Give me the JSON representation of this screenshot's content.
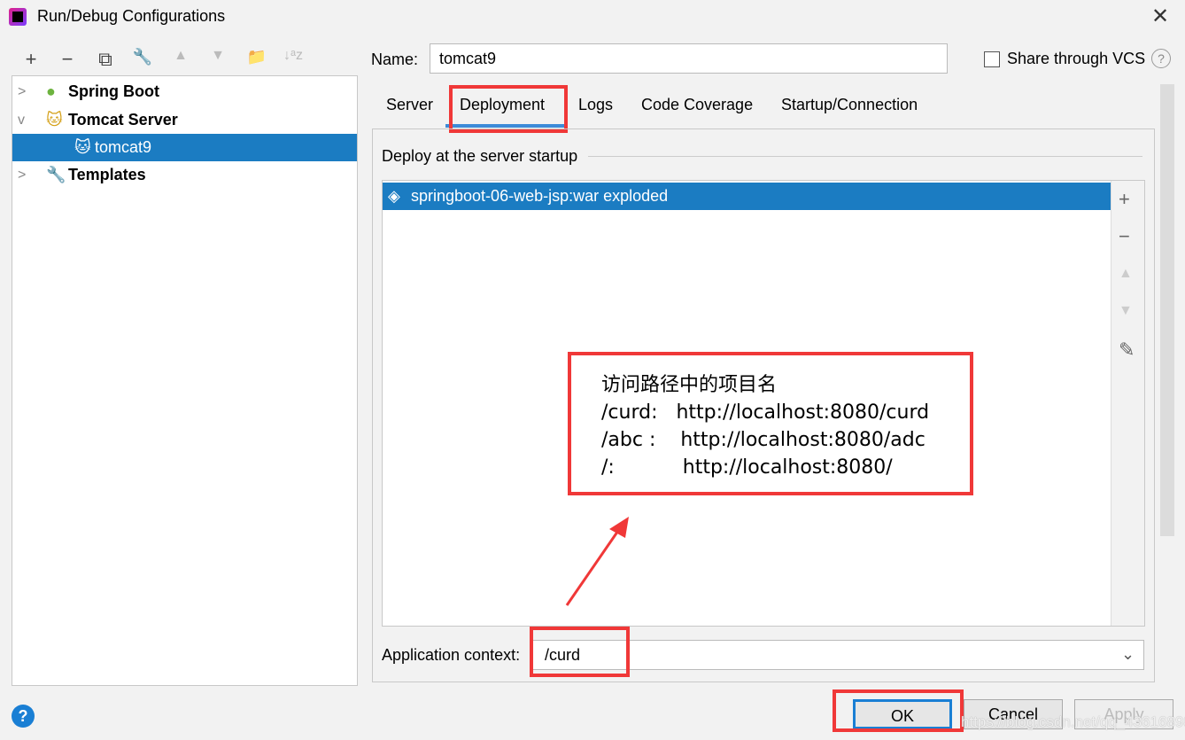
{
  "window": {
    "title": "Run/Debug Configurations",
    "close": "✕"
  },
  "toolbar": [
    "+",
    "−",
    "⧉",
    "🔧",
    "▲",
    "▼",
    "📁",
    "↓ᵃz"
  ],
  "tree": [
    {
      "label": "Spring Boot",
      "expanded": false
    },
    {
      "label": "Tomcat Server",
      "expanded": true
    },
    {
      "label": "tomcat9",
      "selected": true
    },
    {
      "label": "Templates",
      "expanded": false
    }
  ],
  "name": {
    "label": "Name:",
    "value": "tomcat9"
  },
  "share_vcs": {
    "label": "Share through VCS",
    "checked": false
  },
  "tabs": [
    {
      "label": "Server"
    },
    {
      "label": "Deployment",
      "active": true
    },
    {
      "label": "Logs"
    },
    {
      "label": "Code Coverage"
    },
    {
      "label": "Startup/Connection"
    }
  ],
  "deploy": {
    "heading": "Deploy at the server startup",
    "items": [
      "springboot-06-web-jsp:war exploded"
    ]
  },
  "app_context": {
    "label": "Application context:",
    "value": "/curd"
  },
  "annotation": {
    "lines": [
      "访问路径中的项目名",
      "/curd:   http://localhost:8080/curd",
      "/abc :    http://localhost:8080/adc",
      "/:           http://localhost:8080/"
    ],
    "color": "#f03838"
  },
  "buttons": {
    "ok": "OK",
    "cancel": "Cancel",
    "apply": "Apply"
  },
  "watermark": "https://blog.csdn.net/qq_43616898",
  "colors": {
    "selection": "#1b7cc2",
    "annotation": "#f03838"
  }
}
